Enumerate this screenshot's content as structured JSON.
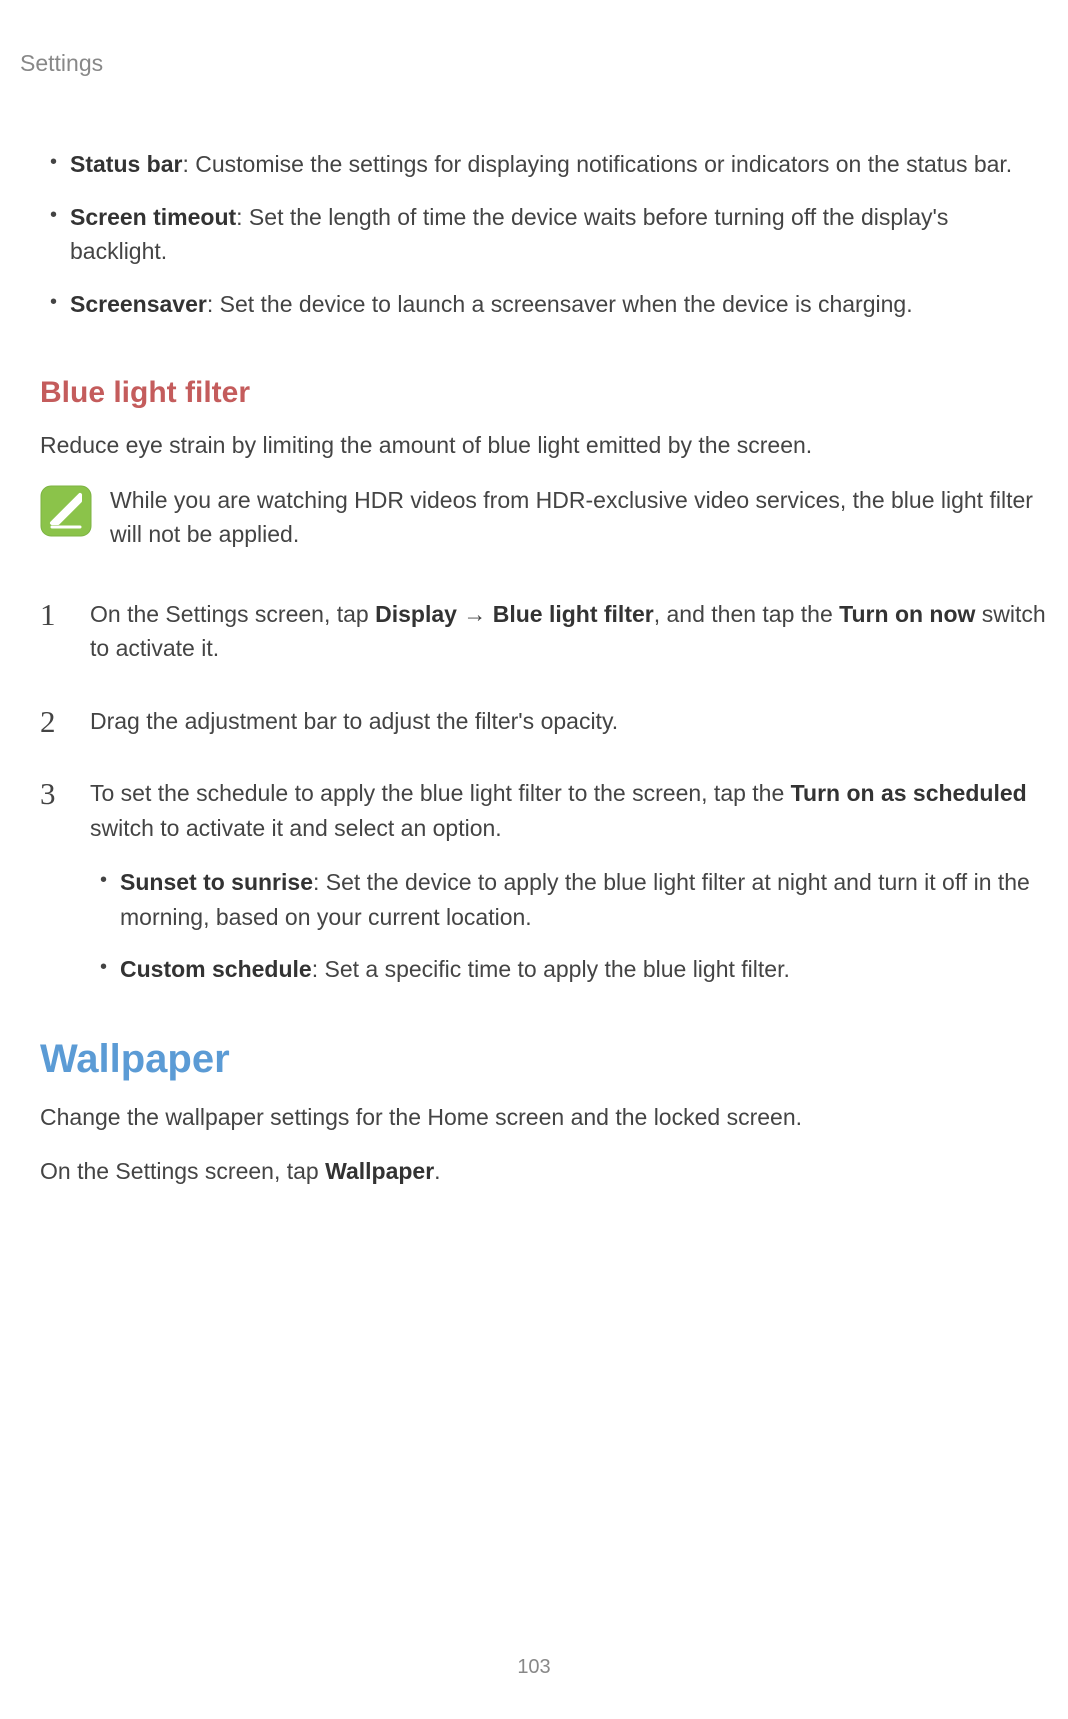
{
  "header": {
    "title": "Settings"
  },
  "initial_bullets": [
    {
      "term": "Status bar",
      "description": ": Customise the settings for displaying notifications or indicators on the status bar."
    },
    {
      "term": "Screen timeout",
      "description": ": Set the length of time the device waits before turning off the display's backlight."
    },
    {
      "term": "Screensaver",
      "description": ": Set the device to launch a screensaver when the device is charging."
    }
  ],
  "blue_light": {
    "heading": "Blue light filter",
    "intro": "Reduce eye strain by limiting the amount of blue light emitted by the screen.",
    "note": "While you are watching HDR videos from HDR-exclusive video services, the blue light filter will not be applied.",
    "step1_prefix": "On the Settings screen, tap ",
    "step1_display": "Display",
    "step1_arrow": " → ",
    "step1_filter": "Blue light filter",
    "step1_mid": ", and then tap the ",
    "step1_turnon": "Turn on now",
    "step1_suffix": " switch to activate it.",
    "step2": "Drag the adjustment bar to adjust the filter's opacity.",
    "step3_prefix": "To set the schedule to apply the blue light filter to the screen, tap the ",
    "step3_bold": "Turn on as scheduled",
    "step3_suffix": " switch to activate it and select an option.",
    "sub_bullets": [
      {
        "term": "Sunset to sunrise",
        "description": ": Set the device to apply the blue light filter at night and turn it off in the morning, based on your current location."
      },
      {
        "term": "Custom schedule",
        "description": ": Set a specific time to apply the blue light filter."
      }
    ]
  },
  "wallpaper": {
    "heading": "Wallpaper",
    "intro": "Change the wallpaper settings for the Home screen and the locked screen.",
    "instruction_prefix": "On the Settings screen, tap ",
    "instruction_bold": "Wallpaper",
    "instruction_suffix": "."
  },
  "page_number": "103"
}
